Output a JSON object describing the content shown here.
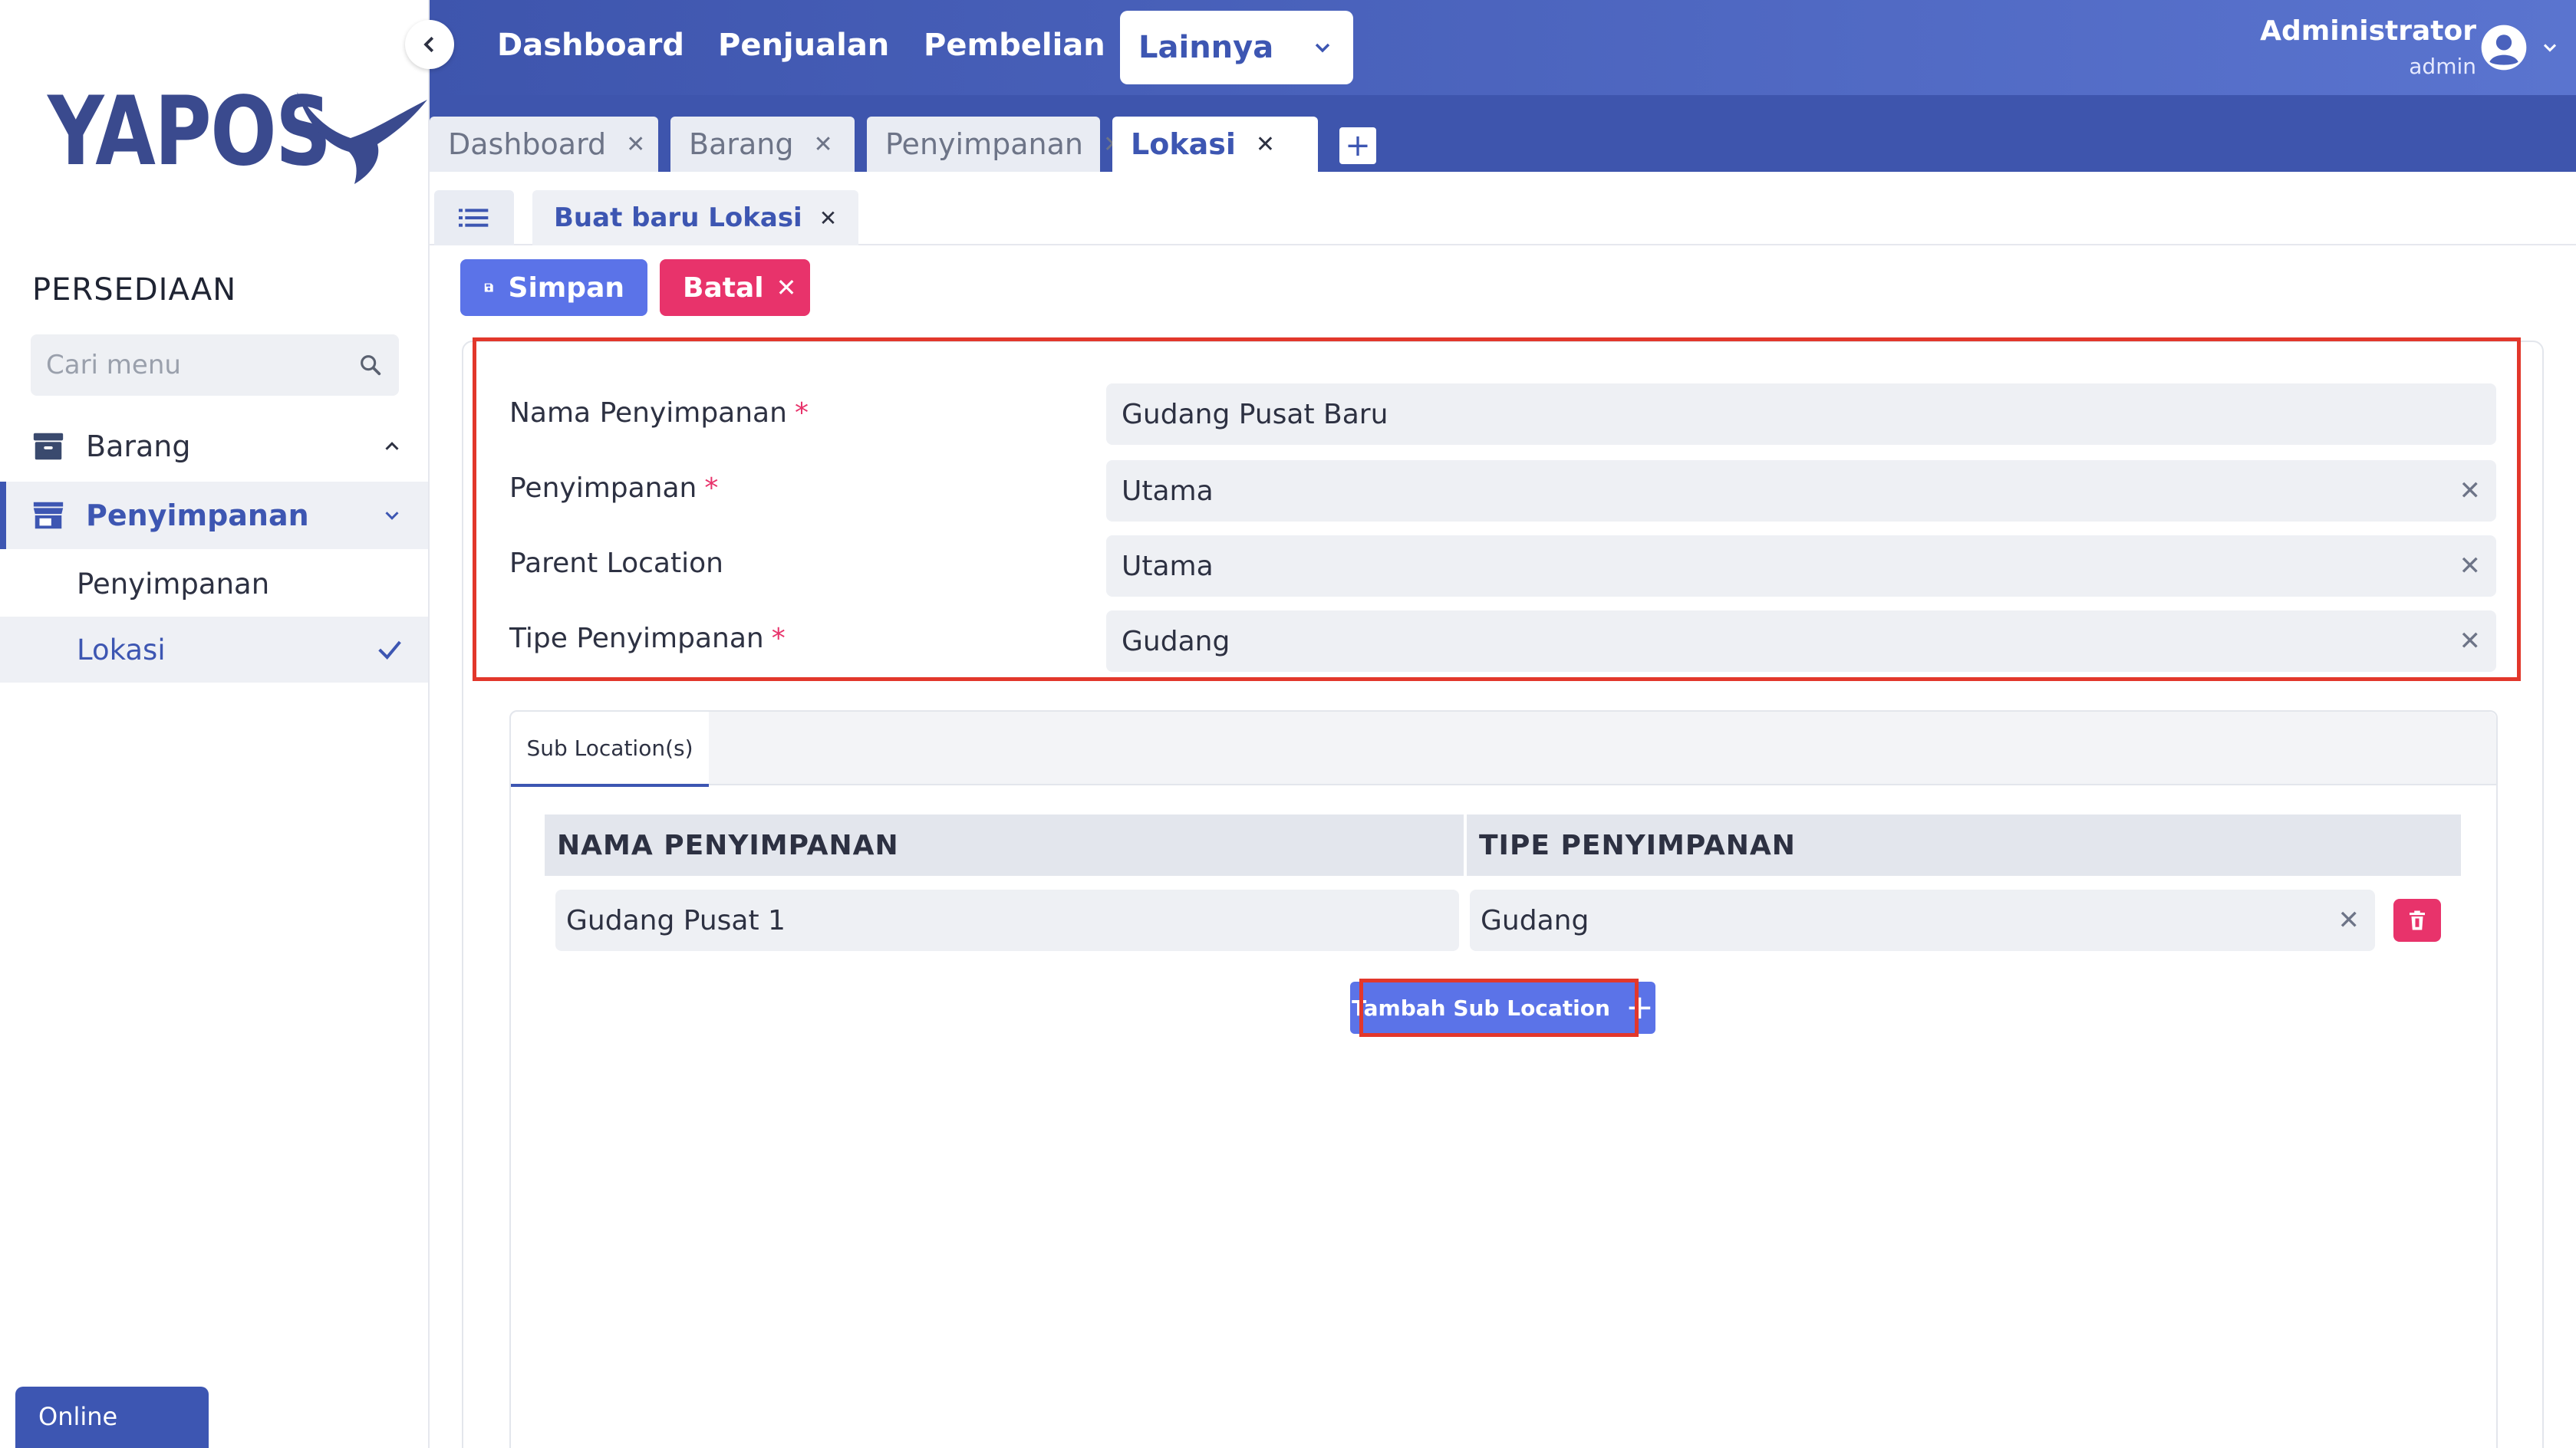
{
  "app": {
    "brand": "YAPOS"
  },
  "sidebar": {
    "section_title": "PERSEDIAAN",
    "search_placeholder": "Cari menu",
    "menu": [
      {
        "label": "Barang",
        "expanded": true
      },
      {
        "label": "Penyimpanan",
        "expanded": true,
        "active": true
      }
    ],
    "submenu": [
      {
        "label": "Penyimpanan"
      },
      {
        "label": "Lokasi",
        "selected": true
      }
    ],
    "status": "Online"
  },
  "topnav": {
    "items": [
      "Dashboard",
      "Penjualan",
      "Pembelian"
    ],
    "dropdown_label": "Lainnya",
    "user_name": "Administrator",
    "user_role": "admin"
  },
  "tabs": [
    {
      "label": "Dashboard",
      "active": false
    },
    {
      "label": "Barang",
      "active": false
    },
    {
      "label": "Penyimpanan",
      "active": false
    },
    {
      "label": "Lokasi",
      "active": true
    }
  ],
  "subtab": {
    "label": "Buat baru Lokasi"
  },
  "actions": {
    "save_label": "Simpan",
    "cancel_label": "Batal"
  },
  "form": {
    "fields": [
      {
        "label": "Nama Penyimpanan",
        "required": true,
        "value": "Gudang Pusat Baru",
        "clearable": false
      },
      {
        "label": "Penyimpanan",
        "required": true,
        "value": "Utama",
        "clearable": true
      },
      {
        "label": "Parent Location",
        "required": false,
        "value": "Utama",
        "clearable": true
      },
      {
        "label": "Tipe Penyimpanan",
        "required": true,
        "value": "Gudang",
        "clearable": true
      }
    ]
  },
  "sublocations": {
    "tab_label": "Sub Location(s)",
    "columns": [
      "NAMA PENYIMPANAN",
      "TIPE PENYIMPANAN"
    ],
    "rows": [
      {
        "name": "Gudang Pusat 1",
        "type": "Gudang"
      }
    ],
    "add_button_label": "Tambah Sub Location"
  },
  "colors": {
    "primary": "#3d56b2",
    "button_primary": "#5b73e8",
    "danger": "#e8336b",
    "highlight": "#e2372b"
  }
}
